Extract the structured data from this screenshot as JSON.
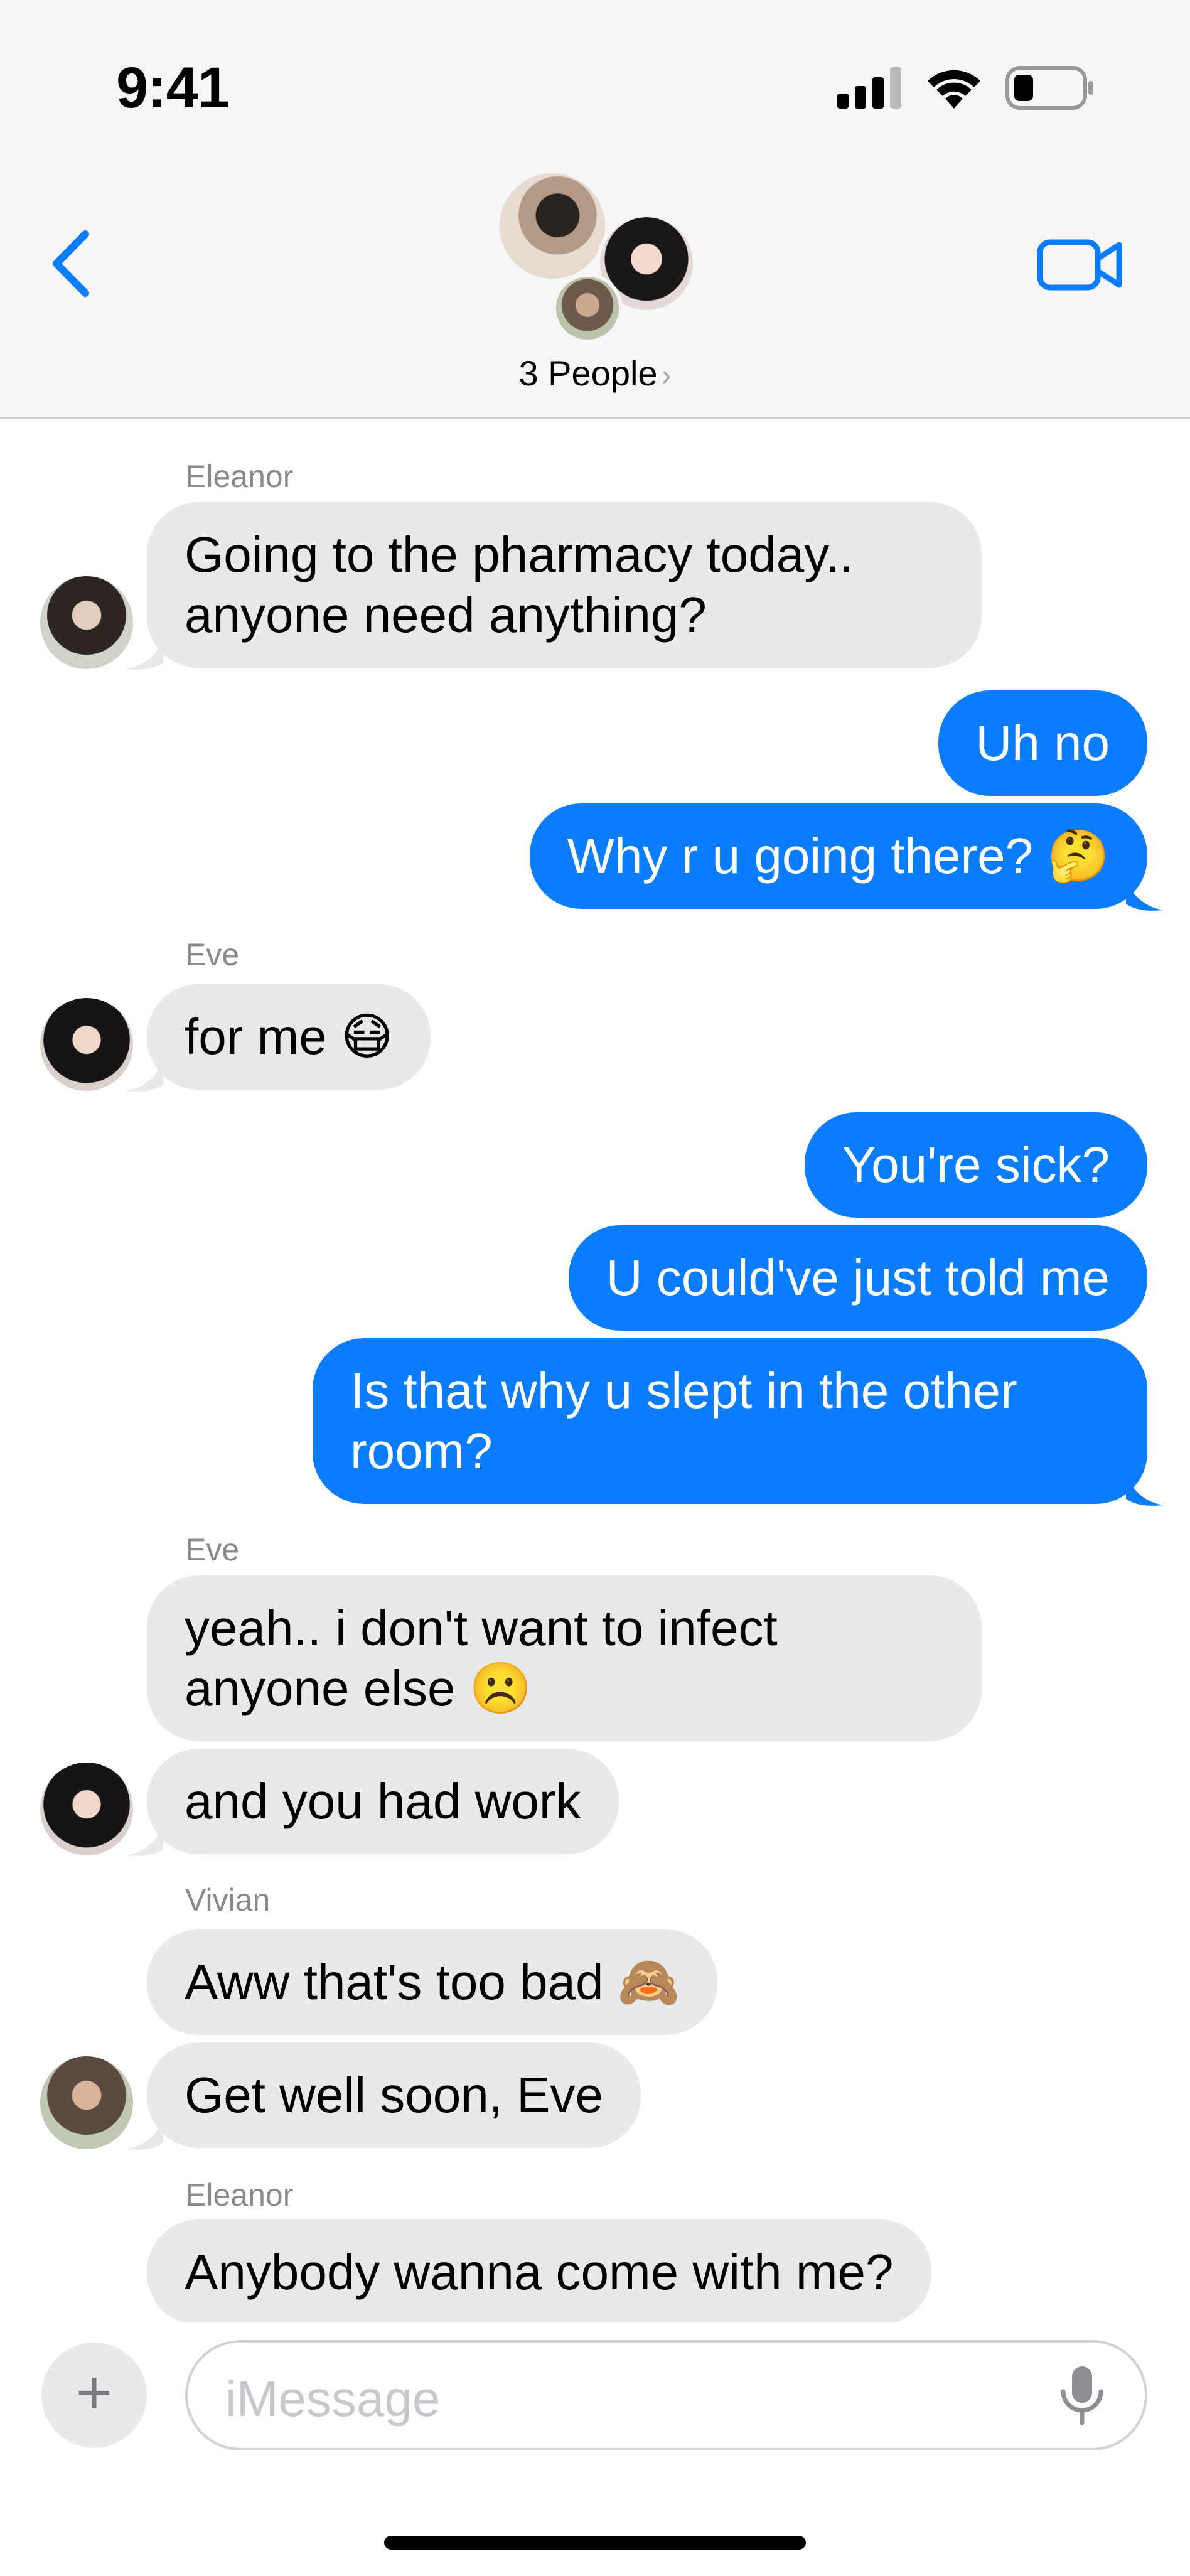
{
  "status": {
    "time": "9:41"
  },
  "header": {
    "group_label": "3 People",
    "chevron": "›"
  },
  "messages": [
    {
      "sender": "Eleanor",
      "lines": [
        "Going to the pharmacy today..",
        "anyone need anything?"
      ]
    },
    {
      "text": "Uh no"
    },
    {
      "text": "Why r u going there? 🤔"
    },
    {
      "sender": "Eve",
      "text": "for me 😷"
    },
    {
      "text": "You're sick?"
    },
    {
      "text": "U could've just told me"
    },
    {
      "lines": [
        "Is that why u slept in the other",
        "room?"
      ]
    },
    {
      "sender": "Eve",
      "lines": [
        "yeah.. i don't want to infect",
        "anyone else ☹️"
      ]
    },
    {
      "text": "and you had work"
    },
    {
      "sender": "Vivian",
      "text": "Aww that's too bad 🙈"
    },
    {
      "text": "Get well soon, Eve"
    },
    {
      "sender": "Eleanor",
      "text": "Anybody wanna come with me?"
    }
  ],
  "composer": {
    "placeholder": "iMessage",
    "plus": "+"
  },
  "colors": {
    "sent": "#0a7cff",
    "received": "#e9e9eb",
    "accent": "#0a7cff"
  },
  "icons": [
    "cellular-signal-icon",
    "wifi-icon",
    "battery-icon",
    "back-chevron-icon",
    "video-call-icon",
    "microphone-icon"
  ]
}
